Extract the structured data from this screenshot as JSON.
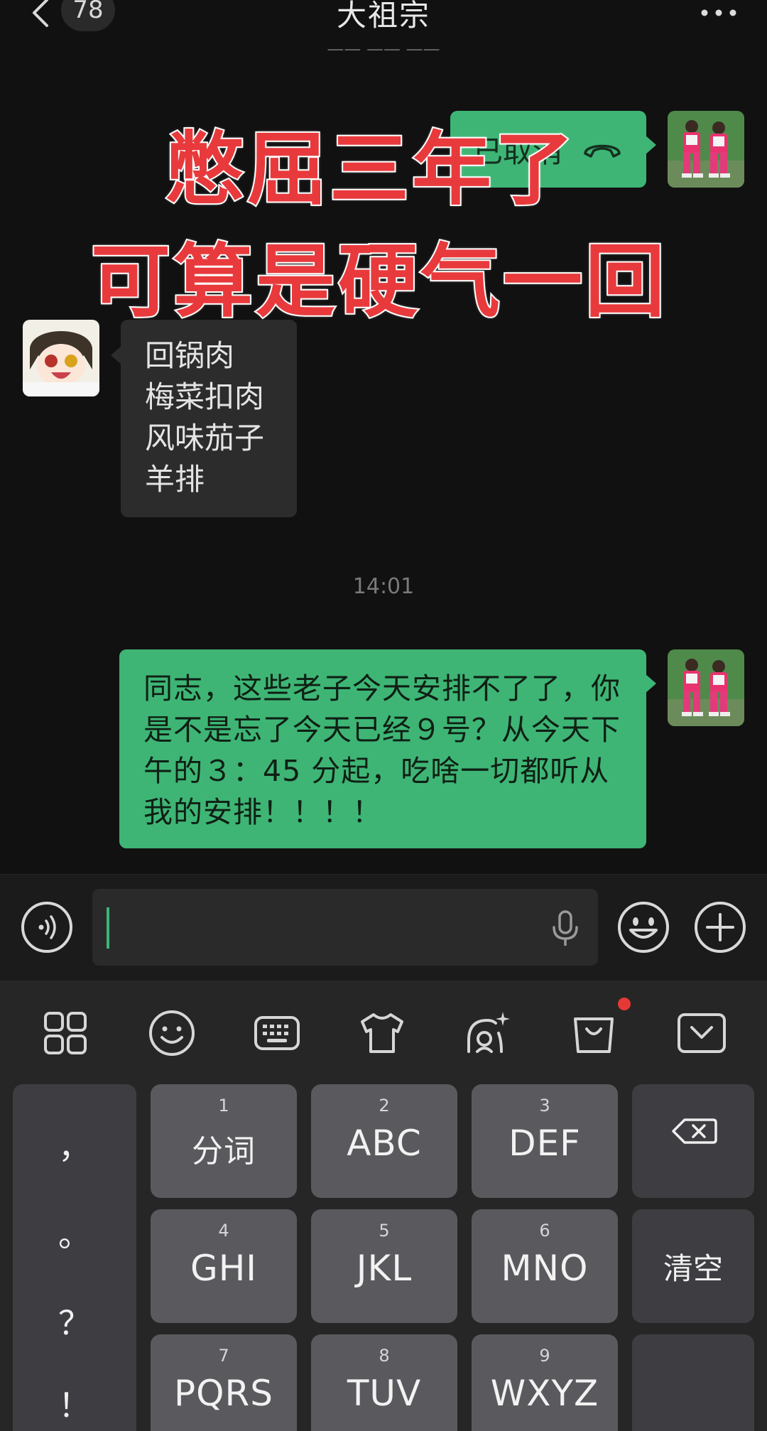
{
  "header": {
    "unread_count": "78",
    "title": "大祖宗"
  },
  "messages": {
    "cut_timestamp": "—— —— ——",
    "call_status": "已取消",
    "dishes": [
      "回锅肉",
      "梅菜扣肉",
      "风味茄子",
      "羊排"
    ],
    "time_divider": "14:01",
    "reply": "同志，这些老子今天安排不了了，你是不是忘了今天已经９号？从今天下午的３：45 分起，吃啥一切都听从我的安排！！！！"
  },
  "overlay": {
    "line1": "憋屈三年了",
    "line2": "可算是硬气一回"
  },
  "input": {
    "value": "",
    "placeholder": ""
  },
  "keyboard": {
    "punct": [
      "，",
      "。",
      "？",
      "！"
    ],
    "keys": [
      {
        "num": "1",
        "label": "分词"
      },
      {
        "num": "2",
        "label": "ABC"
      },
      {
        "num": "3",
        "label": "DEF"
      },
      {
        "num": "4",
        "label": "GHI"
      },
      {
        "num": "5",
        "label": "JKL"
      },
      {
        "num": "6",
        "label": "MNO"
      },
      {
        "num": "7",
        "label": "PQRS"
      },
      {
        "num": "8",
        "label": "TUV"
      },
      {
        "num": "9",
        "label": "WXYZ"
      }
    ],
    "clear_label": "清空"
  },
  "icons": {
    "back": "back-chevron-icon",
    "more": "more-dots-icon",
    "call": "phone-hangup-icon",
    "voice": "voice-wave-icon",
    "mic": "microphone-icon",
    "emoji": "emoji-smile-icon",
    "plus": "plus-icon",
    "toolbar": [
      "grid-icon",
      "smiley-icon",
      "keyboard-icon",
      "shirt-icon",
      "ai-sparkle-icon",
      "shopping-bag-icon",
      "collapse-keyboard-icon"
    ],
    "delete": "backspace-icon"
  },
  "colors": {
    "background": "#111111",
    "bubble_green": "#3eb575",
    "bubble_gray": "#2c2c2c",
    "overlay_red": "#e83a3c",
    "badge_red": "#e53935"
  }
}
